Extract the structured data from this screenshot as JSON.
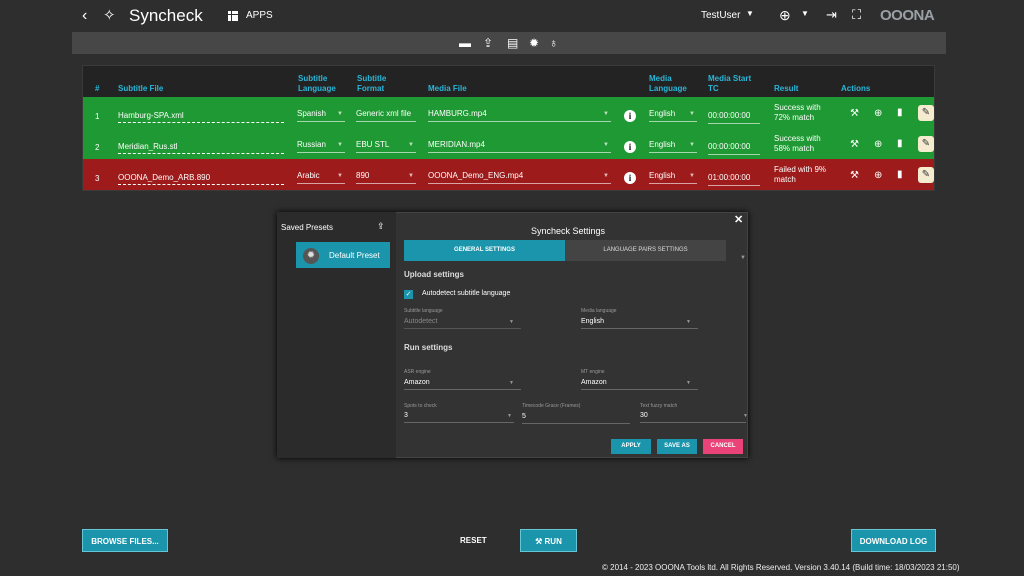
{
  "header": {
    "back": "‹",
    "title": "Syncheck",
    "apps_label": "APPS",
    "user": "TestUser",
    "logo": "OOONA"
  },
  "table": {
    "columns": [
      "#",
      "Subtitle File",
      "Subtitle Language",
      "Subtitle Format",
      "Media File",
      "Media Language",
      "Media Start TC",
      "Result",
      "Actions"
    ],
    "rows": [
      {
        "num": "1",
        "file": "Hamburg-SPA.xml",
        "lang": "Spanish",
        "format": "Generic xml file",
        "media": "HAMBURG.mp4",
        "media_lang": "English",
        "tc": "00:00:00:00",
        "result_1": "Success with",
        "result_2": "72% match",
        "status": "ok"
      },
      {
        "num": "2",
        "file": "Meridian_Rus.stl",
        "lang": "Russian",
        "format": "EBU STL",
        "media": "MERIDIAN.mp4",
        "media_lang": "English",
        "tc": "00:00:00:00",
        "result_1": "Success with",
        "result_2": "58% match",
        "status": "ok"
      },
      {
        "num": "3",
        "file": "OOONA_Demo_ARB.890",
        "lang": "Arabic",
        "format": "890",
        "media": "OOONA_Demo_ENG.mp4",
        "media_lang": "English",
        "tc": "01:00:00:00",
        "result_1": "Failed with 9%",
        "result_2": "match",
        "status": "fail"
      }
    ]
  },
  "presets": {
    "heading": "Saved Presets",
    "items": [
      "Default Preset"
    ]
  },
  "dialog": {
    "title": "Syncheck Settings",
    "tabs": [
      "GENERAL SETTINGS",
      "LANGUAGE PAIRS SETTINGS"
    ],
    "upload_heading": "Upload settings",
    "autodetect_label": "Autodetect subtitle language",
    "autodetect_checked": true,
    "subtitle_language_label": "Subtitle language",
    "subtitle_language_value": "Autodetect",
    "media_language_label": "Media language",
    "media_language_value": "English",
    "run_heading": "Run settings",
    "asr_label": "ASR engine",
    "asr_value": "Amazon",
    "mt_label": "MT engine",
    "mt_value": "Amazon",
    "spots_label": "Spots to check",
    "spots_value": "3",
    "grace_label": "Timecode Grace (Frames)",
    "grace_value": "5",
    "fuzzy_label": "Text fuzzy match",
    "fuzzy_value": "30",
    "apply": "APPLY",
    "save_as": "SAVE AS",
    "cancel": "CANCEL"
  },
  "bottom": {
    "browse": "BROWSE FILES...",
    "reset": "RESET",
    "run": "RUN",
    "download_log": "DOWNLOAD LOG"
  },
  "footer": "© 2014 - 2023 OOONA Tools ltd. All Rights Reserved. Version 3.40.14 (Build time: 18/03/2023 21:50)",
  "colors": {
    "accent": "#1a95ab",
    "success_row": "#1f9933",
    "fail_row": "#9e1b1b",
    "cancel": "#e9437a",
    "header_text": "#29b6d8"
  },
  "icons": [
    "back-icon",
    "wand-icon",
    "apps-grid-icon",
    "globe-icon",
    "exit-icon",
    "fullscreen-icon",
    "folder-icon",
    "upload-icon",
    "save-icon",
    "settings-icon",
    "lightbulb-icon",
    "info-icon",
    "wand-icon",
    "plus-icon",
    "trash-icon",
    "edit-icon"
  ]
}
